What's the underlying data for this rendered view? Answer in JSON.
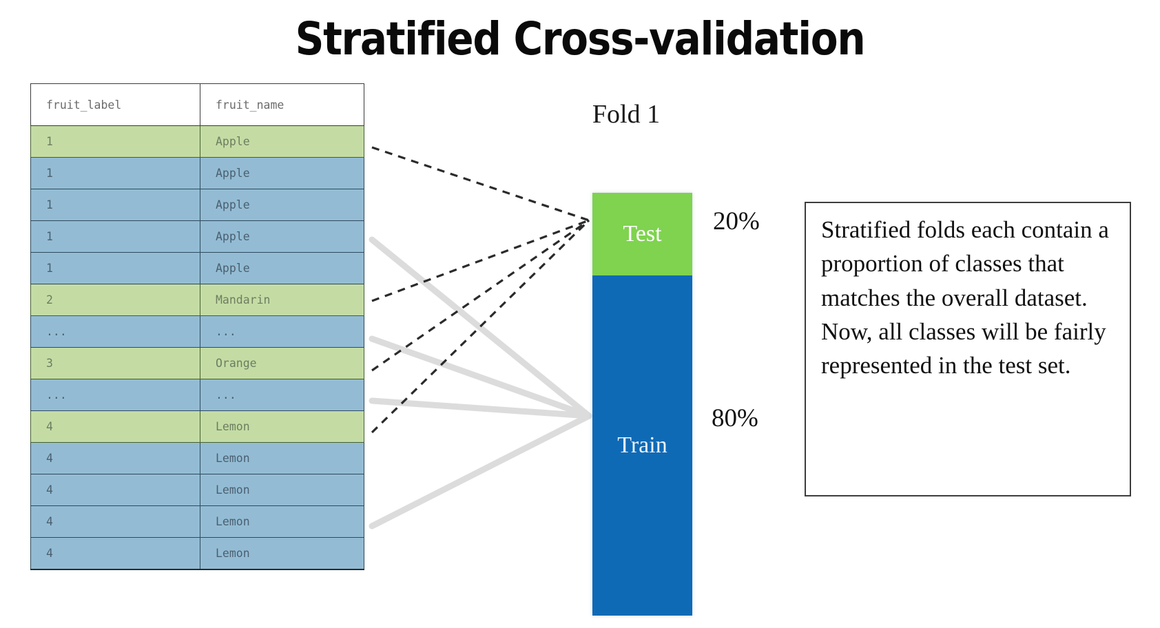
{
  "slide": {
    "title": "Stratified Cross-validation",
    "background_color": "#ffffff"
  },
  "table": {
    "columns": [
      "fruit_label",
      "fruit_name"
    ],
    "header_text_color": "#6b6b6b",
    "green_row_color": "#c4dca4",
    "blue_row_color": "#93bcd4",
    "rows": [
      {
        "fruit_label": "1",
        "fruit_name": "Apple",
        "highlight": "green"
      },
      {
        "fruit_label": "1",
        "fruit_name": "Apple",
        "highlight": "blue"
      },
      {
        "fruit_label": "1",
        "fruit_name": "Apple",
        "highlight": "blue"
      },
      {
        "fruit_label": "1",
        "fruit_name": "Apple",
        "highlight": "blue"
      },
      {
        "fruit_label": "1",
        "fruit_name": "Apple",
        "highlight": "blue"
      },
      {
        "fruit_label": "2",
        "fruit_name": "Mandarin",
        "highlight": "green"
      },
      {
        "fruit_label": "...",
        "fruit_name": "...",
        "highlight": "blue"
      },
      {
        "fruit_label": "3",
        "fruit_name": "Orange",
        "highlight": "green"
      },
      {
        "fruit_label": "...",
        "fruit_name": "...",
        "highlight": "blue"
      },
      {
        "fruit_label": "4",
        "fruit_name": "Lemon",
        "highlight": "green"
      },
      {
        "fruit_label": "4",
        "fruit_name": "Lemon",
        "highlight": "blue"
      },
      {
        "fruit_label": "4",
        "fruit_name": "Lemon",
        "highlight": "blue"
      },
      {
        "fruit_label": "4",
        "fruit_name": "Lemon",
        "highlight": "blue"
      },
      {
        "fruit_label": "4",
        "fruit_name": "Lemon",
        "highlight": "blue"
      }
    ]
  },
  "fold": {
    "label": "Fold 1"
  },
  "split_bar": {
    "test": {
      "label": "Test",
      "percent_label": "20%",
      "color": "#7fd34f",
      "fraction": 0.2
    },
    "train": {
      "label": "Train",
      "percent_label": "80%",
      "color": "#0f6ab6",
      "fraction": 0.8
    }
  },
  "callout": {
    "text": "Stratified folds each contain a proportion of classes that matches the overall dataset. Now, all classes will be fairly represented in the test set."
  },
  "connectors": {
    "test_line_style": "dashed",
    "test_line_color": "#2b2b2b",
    "train_line_style": "solid",
    "train_line_color": "#dcdcdc"
  }
}
